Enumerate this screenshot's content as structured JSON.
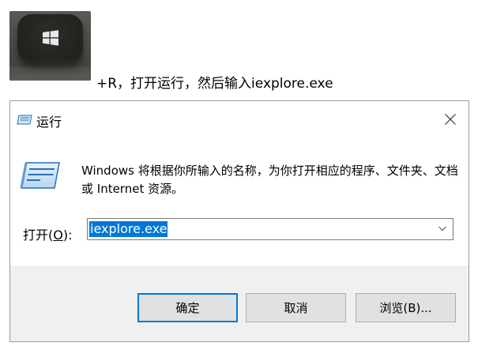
{
  "instruction": {
    "text": "+R，打开运行，然后输入iexplore.exe"
  },
  "dialog": {
    "title": "运行",
    "description": "Windows 将根据你所输入的名称，为你打开相应的程序、文件夹、文档或 Internet 资源。",
    "open_label_prefix": "打开(",
    "open_label_key": "O",
    "open_label_suffix": "):",
    "input_value": "iexplore.exe",
    "buttons": {
      "ok": "确定",
      "cancel": "取消",
      "browse": "浏览(B)..."
    }
  },
  "colors": {
    "selection": "#0078d7",
    "footer_bg": "#f0f0f0",
    "button_bg": "#e1e1e1"
  },
  "icons": {
    "win_key": "windows-logo-icon",
    "run": "run-icon",
    "close": "close-icon",
    "dropdown": "chevron-down-icon"
  }
}
